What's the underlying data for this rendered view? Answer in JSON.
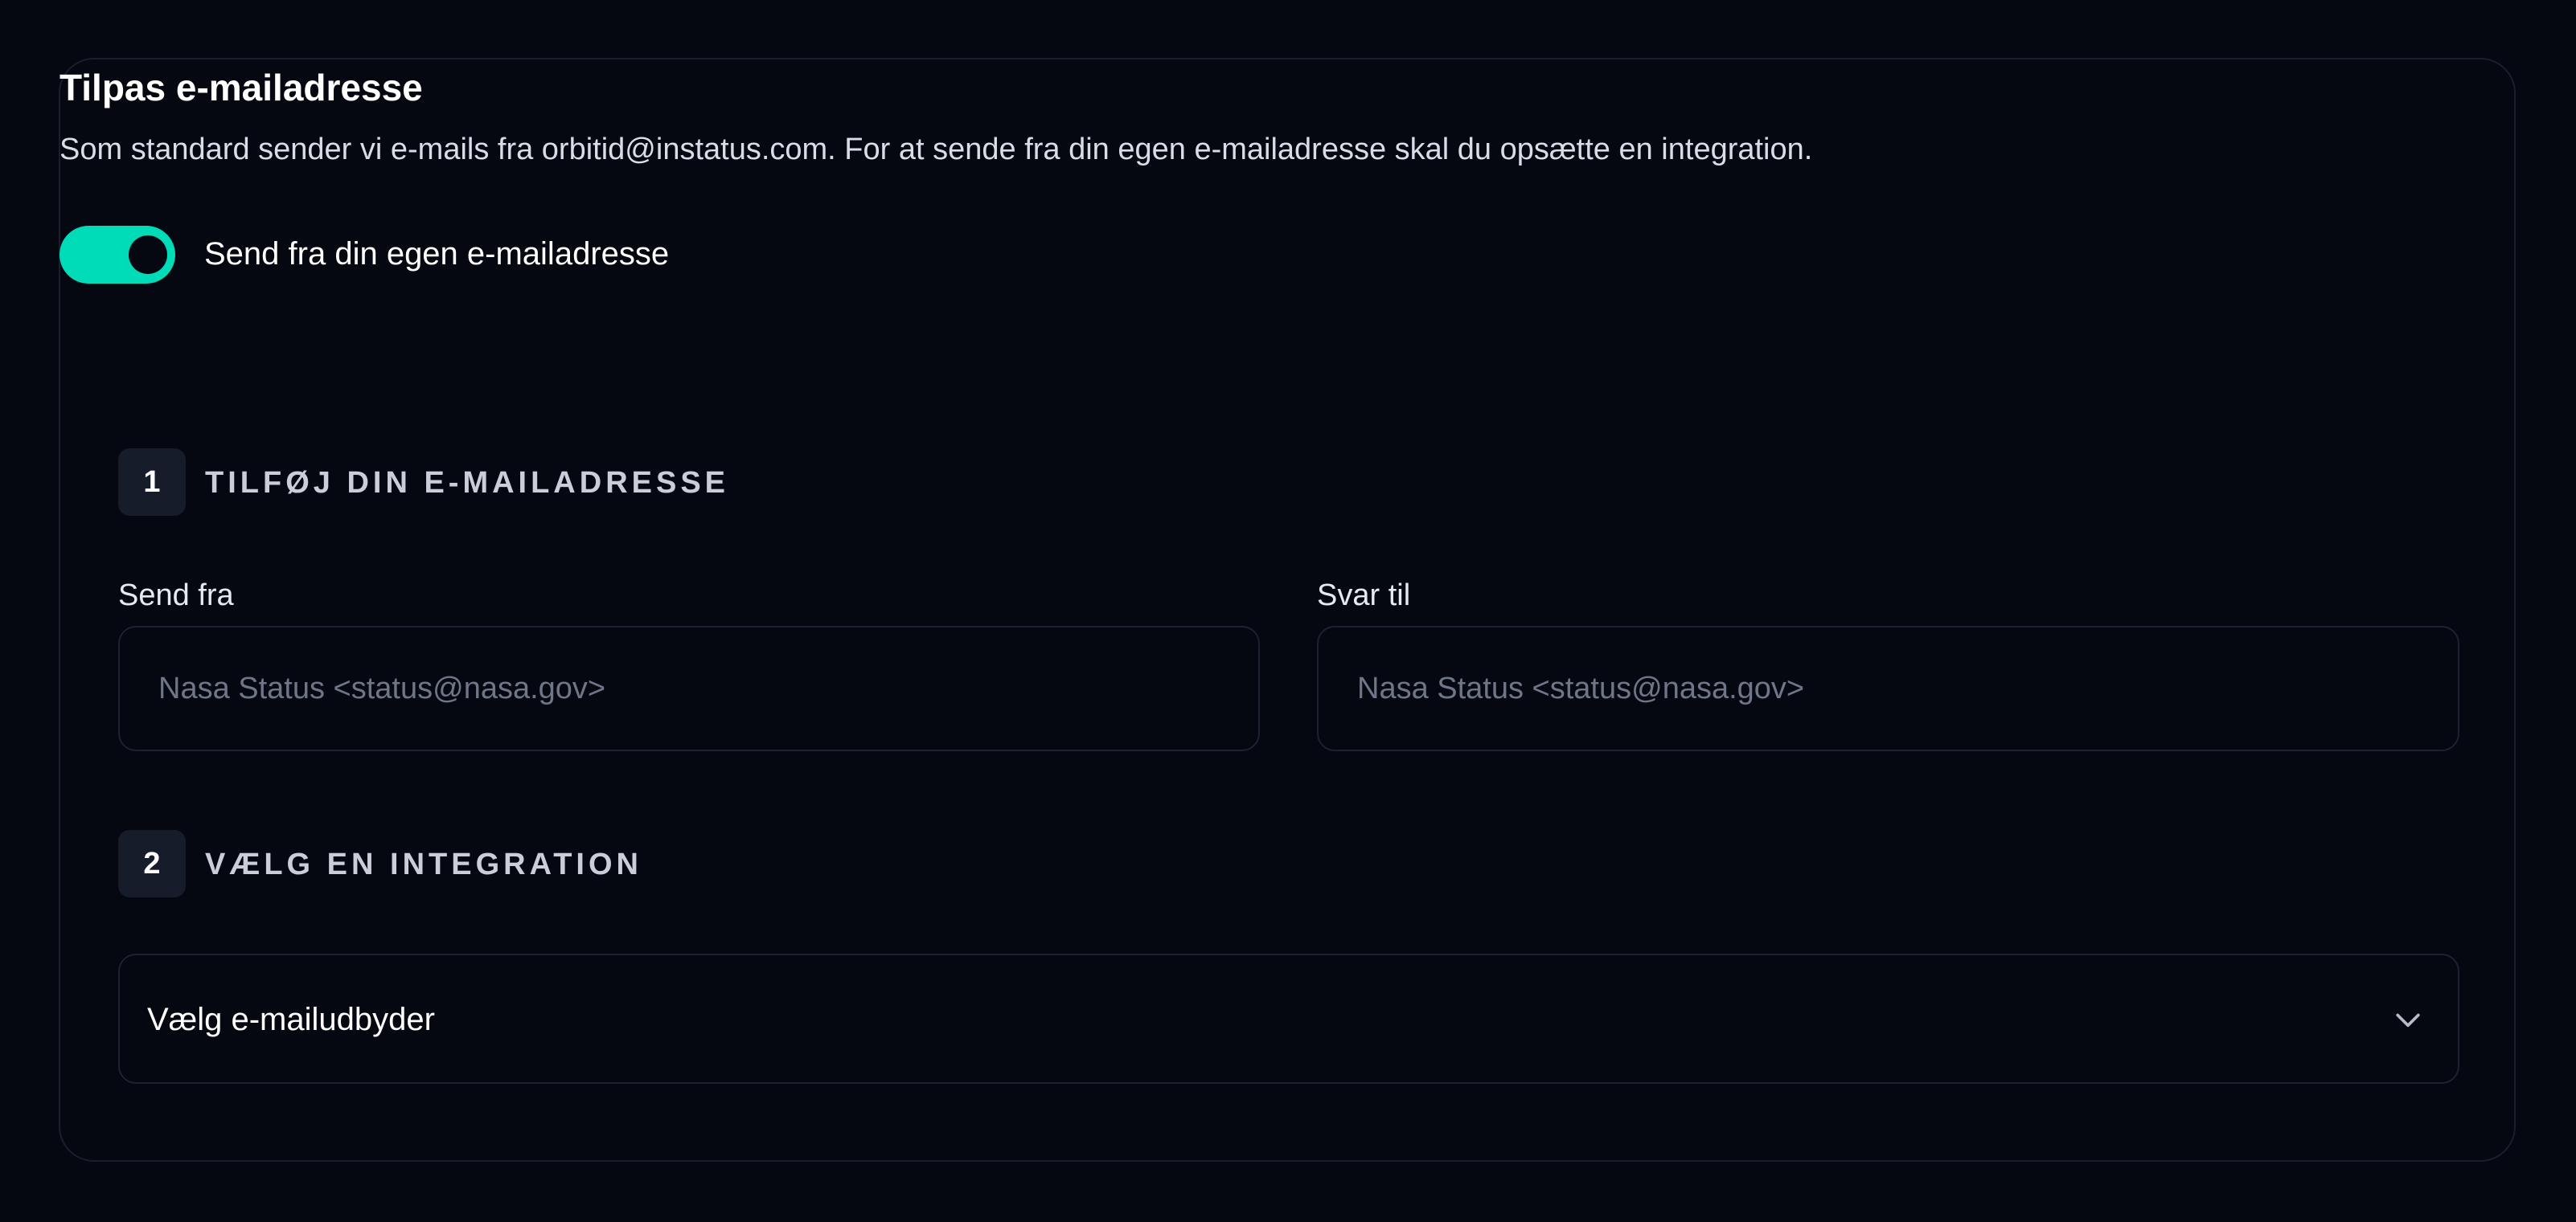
{
  "section": {
    "title": "Tilpas e-mailadresse",
    "description": "Som standard sender vi e-mails fra orbitid@instatus.com. For at sende fra din egen e-mailadresse skal du opsætte en integration."
  },
  "toggle": {
    "label": "Send fra din egen e-mailadresse",
    "enabled": true,
    "color": "#00dcb8"
  },
  "step1": {
    "number": "1",
    "title": "TILFØJ DIN E-MAILADRESSE",
    "send_from": {
      "label": "Send fra",
      "value": "",
      "placeholder": "Nasa Status <status@nasa.gov>"
    },
    "reply_to": {
      "label": "Svar til",
      "value": "",
      "placeholder": "Nasa Status <status@nasa.gov>"
    }
  },
  "step2": {
    "number": "2",
    "title": "VÆLG EN INTEGRATION",
    "provider_select": {
      "value": "Vælg e-mailudbyder",
      "icon": "chevron-down-icon"
    }
  }
}
